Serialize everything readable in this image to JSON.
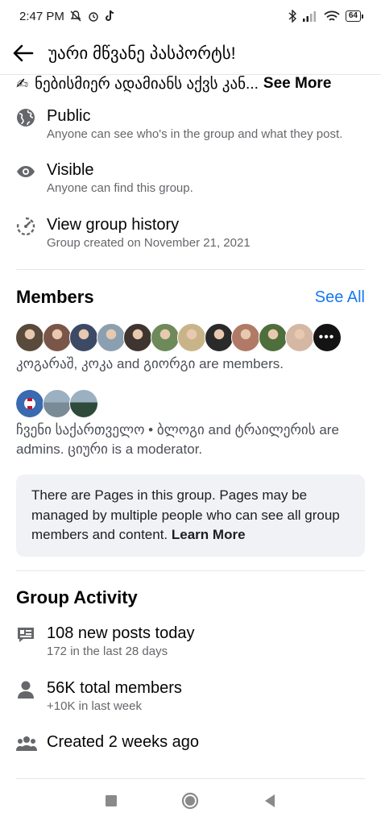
{
  "status_bar": {
    "time": "2:47 PM",
    "battery": "64"
  },
  "header": {
    "title": "უარი მწვანე პასპორტს!"
  },
  "description": {
    "text": "ნებისმიერ ადამიანს აქვს კან...",
    "see_more": "See More"
  },
  "privacy": {
    "label": "Public",
    "sub": "Anyone can see who's in the group and what they post."
  },
  "visibility": {
    "label": "Visible",
    "sub": "Anyone can find this group."
  },
  "history": {
    "label": "View group history",
    "sub": "Group created on November 21, 2021"
  },
  "members": {
    "title": "Members",
    "see_all": "See All",
    "avatar_colors": [
      "#5a4a3c",
      "#7a5648",
      "#3d4a66",
      "#8aa0b0",
      "#3f3530",
      "#6e8a5a",
      "#c9b48a",
      "#2a2a2a",
      "#b07a66",
      "#4e6e3c",
      "#d4b8a4"
    ],
    "more_glyph": "•••",
    "names_line": "კოგარაშ, კოკა and გიორგი are members.",
    "admin_avatar_colors": [
      "#3a6ab0",
      "#7a8a96",
      "#2e4a3a"
    ],
    "admins_line": "ჩვენი საქართველო • ბლოგი and ტრაილერის are admins. ციური is a moderator."
  },
  "pages_notice": {
    "text": "There are Pages in this group. Pages may be managed by multiple people who can see all group members and content.",
    "link": "Learn More"
  },
  "activity": {
    "title": "Group Activity",
    "posts": {
      "label": "108 new posts today",
      "sub": "172 in the last 28 days"
    },
    "total": {
      "label": "56K total members",
      "sub": "+10K in last week"
    },
    "created": {
      "label": "Created 2 weeks ago"
    }
  },
  "icons": {
    "back": "arrow-left-icon",
    "globe": "globe-icon",
    "eye": "eye-icon",
    "history": "history-icon",
    "posts": "posts-icon",
    "person": "person-icon",
    "people": "people-icon"
  }
}
